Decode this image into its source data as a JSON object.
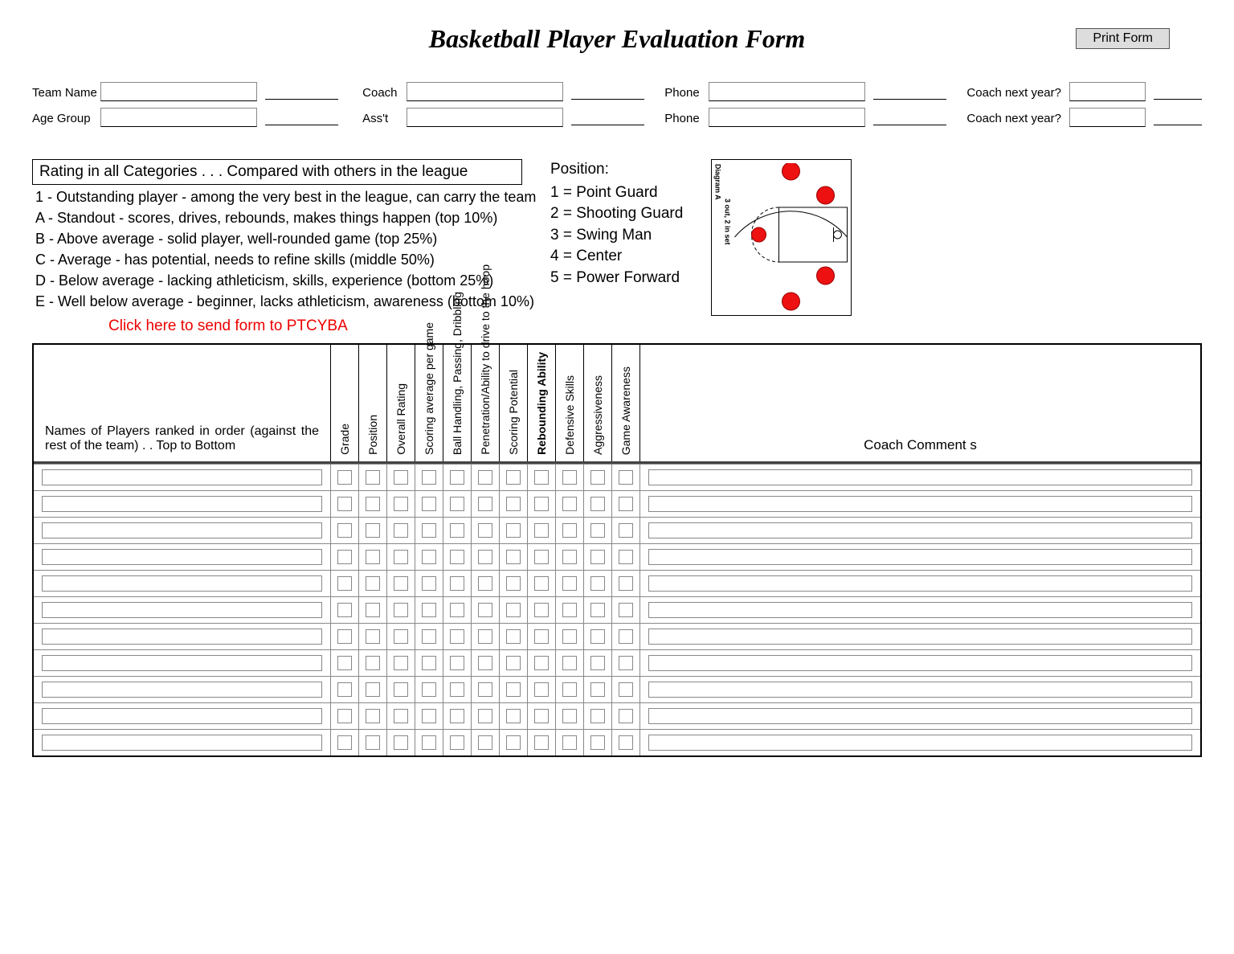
{
  "title": "Basketball Player Evaluation Form",
  "print_button": "Print Form",
  "meta": {
    "team_name_label": "Team Name",
    "coach_label": "Coach",
    "phone_label": "Phone",
    "coach_next_year_label": "Coach next year?",
    "age_group_label": "Age Group",
    "asst_label": "Ass't",
    "phone2_label": "Phone",
    "coach_next_year2_label": "Coach next year?"
  },
  "rating_header": "Rating in all Categories . . . Compared with others in the league",
  "ratings": [
    "1 - Outstanding player - among the very best in the league, can carry the team",
    "A - Standout - scores, drives, rebounds, makes things happen (top 10%)",
    "B - Above average - solid player, well-rounded game (top 25%)",
    "C - Average - has potential, needs to refine skills (middle 50%)",
    "D - Below average - lacking athleticism, skills, experience (bottom 25%)",
    "E - Well below average - beginner, lacks athleticism, awareness (bottom 10%)"
  ],
  "position_title": "Position:",
  "positions": [
    "1 = Point Guard",
    "2 = Shooting Guard",
    "3 = Swing Man",
    "4 = Center",
    "5 = Power Forward"
  ],
  "diagram_label1": "Diagram A",
  "diagram_label2": "3 out, 2 in set",
  "send_link": "Click here to send form to PTCYBA",
  "table": {
    "names_header": "Names of Players ranked in order (against the rest of the team) . . Top to Bottom",
    "skill_headers": [
      {
        "text": "Grade",
        "bold": false
      },
      {
        "text": "Position",
        "bold": false
      },
      {
        "text": "Overall Rating",
        "bold": false
      },
      {
        "text": "Scoring average per game",
        "bold": false
      },
      {
        "text": "Ball Handling, Passing, Dribbling",
        "bold": false
      },
      {
        "text": "Penetration/Ability to drive to the hoop",
        "bold": false
      },
      {
        "text": "Scoring Potential",
        "bold": false
      },
      {
        "text": "Rebounding Ability",
        "bold": true
      },
      {
        "text": "Defensive Skills",
        "bold": false
      },
      {
        "text": "Aggressiveness",
        "bold": false
      },
      {
        "text": "Game Awareness",
        "bold": false
      }
    ],
    "comments_header": "Coach Comment s",
    "row_count": 11
  }
}
